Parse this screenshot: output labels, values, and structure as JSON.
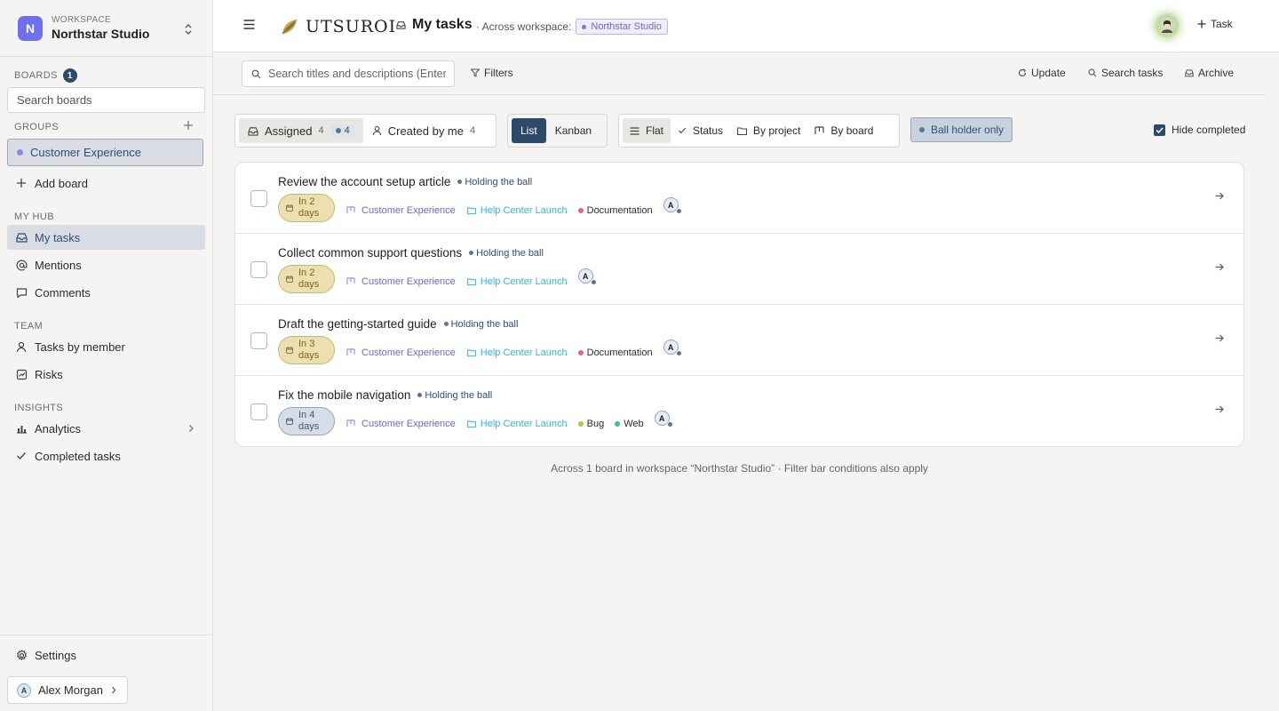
{
  "workspace": {
    "label": "WORKSPACE",
    "name": "Northstar Studio",
    "initial": "N"
  },
  "sidebar": {
    "boards_label": "BOARDS",
    "boards_count": "1",
    "search_placeholder": "Search boards",
    "groups_label": "GROUPS",
    "group_item": "Customer Experience",
    "add_board": "Add board",
    "my_hub_label": "MY HUB",
    "my_tasks": "My tasks",
    "mentions": "Mentions",
    "comments": "Comments",
    "team_label": "TEAM",
    "tasks_by_member": "Tasks by member",
    "risks": "Risks",
    "insights_label": "INSIGHTS",
    "analytics": "Analytics",
    "completed_tasks": "Completed tasks",
    "settings": "Settings",
    "user_name": "Alex Morgan",
    "user_initial": "A"
  },
  "header": {
    "logo": "UTSUROI",
    "title": "My tasks",
    "across_label": "· Across workspace:",
    "workspace_chip": "Northstar Studio",
    "new_task": "Task"
  },
  "toolbar": {
    "search_placeholder": "Search titles and descriptions (Enter)",
    "filters": "Filters",
    "update": "Update",
    "search_tasks": "Search tasks",
    "archive": "Archive"
  },
  "filters": {
    "assigned_label": "Assigned",
    "assigned_count": "4",
    "assigned_ball_count": "4",
    "created_label": "Created by me",
    "created_count": "4",
    "view_list": "List",
    "view_kanban": "Kanban",
    "group_flat": "Flat",
    "group_status": "Status",
    "group_project": "By project",
    "group_board": "By board",
    "ball_holder_only": "Ball holder only",
    "hide_completed": "Hide completed",
    "hide_completed_checked": true
  },
  "tasks": [
    {
      "title": "Review the account setup article",
      "ball": "Holding the ball",
      "due_line1": "In 2",
      "due_line2": "days",
      "due_state": "warn",
      "board": "Customer Experience",
      "project": "Help Center Launch",
      "tags": [
        {
          "label": "Documentation",
          "color": "#e8647a"
        }
      ],
      "assignee": "A"
    },
    {
      "title": "Collect common support questions",
      "ball": "Holding the ball",
      "due_line1": "In 2",
      "due_line2": "days",
      "due_state": "warn",
      "board": "Customer Experience",
      "project": "Help Center Launch",
      "tags": [],
      "assignee": "A"
    },
    {
      "title": "Draft the getting-started guide",
      "ball": "Holding the ball",
      "due_line1": "In 3",
      "due_line2": "days",
      "due_state": "warn",
      "board": "Customer Experience",
      "project": "Help Center Launch",
      "tags": [
        {
          "label": "Documentation",
          "color": "#e8647a"
        }
      ],
      "assignee": "A"
    },
    {
      "title": "Fix the mobile navigation",
      "ball": "Holding the ball",
      "due_line1": "In 4",
      "due_line2": "days",
      "due_state": "calm",
      "board": "Customer Experience",
      "project": "Help Center Launch",
      "tags": [
        {
          "label": "Bug",
          "color": "#a4cc3c"
        },
        {
          "label": "Web",
          "color": "#3cc47c"
        }
      ],
      "assignee": "A"
    }
  ],
  "footer_note": "Across 1 board in workspace “Northstar Studio” · Filter bar conditions also apply",
  "colors": {
    "accent": "#2e4a6b",
    "workspace": "#6f6ff0",
    "board": "#6a68d8",
    "project": "#2fb8d8"
  }
}
